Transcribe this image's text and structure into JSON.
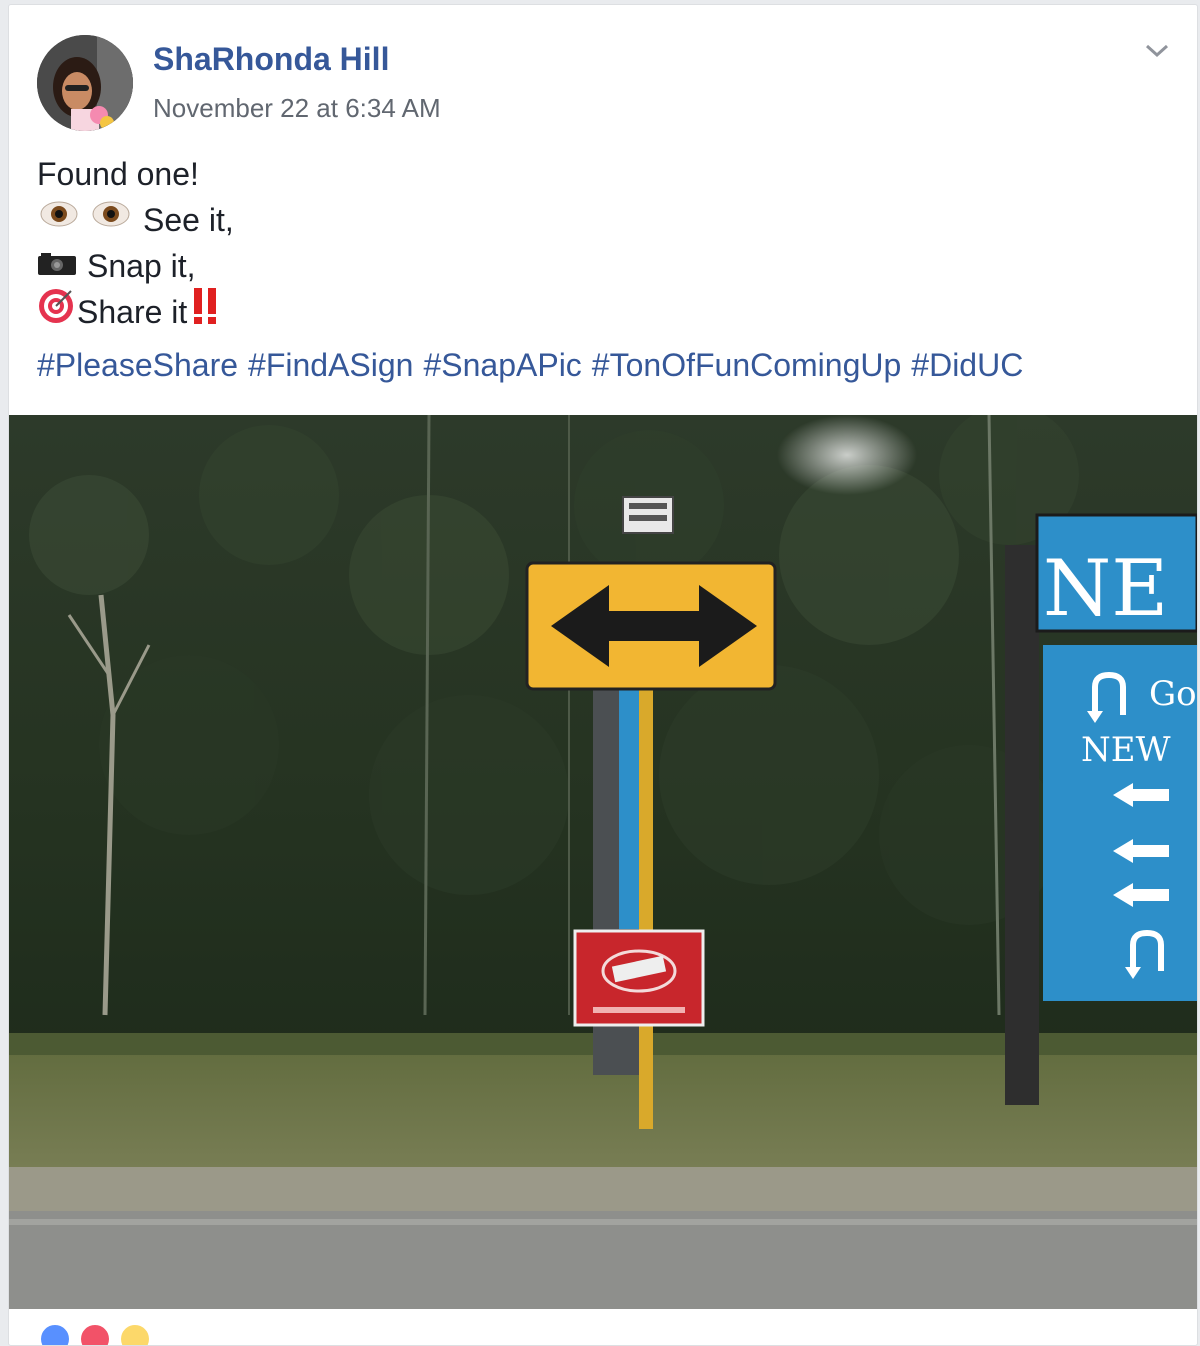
{
  "post": {
    "author": "ShaRhonda Hill",
    "timestamp": "November 22 at 6:34 AM",
    "lines": [
      "Found one!",
      "See it,",
      "Snap it,",
      "Share it"
    ],
    "hashtags": [
      "#PleaseShare",
      "#FindASign",
      "#SnapAPic",
      "#TonOfFunComingUp",
      "#DidUC"
    ]
  },
  "photo": {
    "sign_text_top": "NE",
    "sign_text_line1": "Go",
    "sign_text_line2": "NEW"
  },
  "colors": {
    "link": "#365899",
    "text": "#1d2129",
    "meta": "#616770",
    "sign_yellow": "#f2b632",
    "sign_blue": "#2d8fc9"
  },
  "icons": {
    "eyes": "eyes-icon",
    "camera": "camera-icon",
    "target": "target-icon",
    "exclamation": "double-exclamation-icon",
    "menu": "chevron-down-icon"
  }
}
